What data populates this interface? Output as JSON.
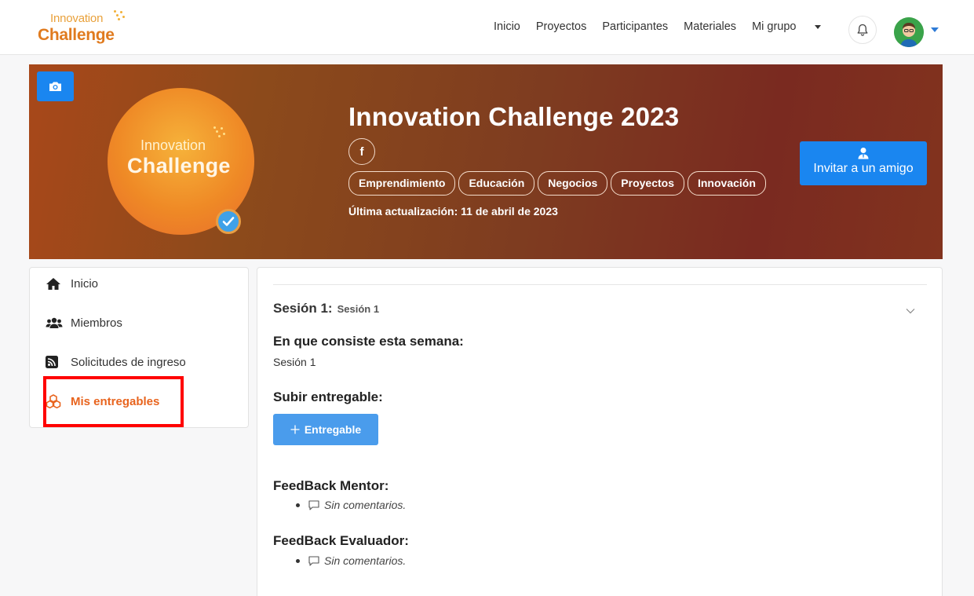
{
  "nav": {
    "logo_top": "Innovation",
    "logo_bottom": "Challenge",
    "links": [
      "Inicio",
      "Proyectos",
      "Participantes",
      "Materiales"
    ],
    "group_label": "Mi grupo"
  },
  "hero": {
    "badge_top": "Innovation",
    "badge_bottom": "Challenge",
    "title": "Innovation Challenge 2023",
    "fb_icon": "f",
    "tags": [
      "Emprendimiento",
      "Educación",
      "Negocios",
      "Proyectos",
      "Innovación"
    ],
    "updated": "Última actualización: 11 de abril de 2023",
    "invite_label": "Invitar a un amigo"
  },
  "sidebar": {
    "items": [
      {
        "label": "Inicio",
        "icon": "home-icon"
      },
      {
        "label": "Miembros",
        "icon": "users-icon"
      },
      {
        "label": "Solicitudes de ingreso",
        "icon": "rss-icon"
      },
      {
        "label": "Mis entregables",
        "icon": "cubes-icon"
      }
    ]
  },
  "main": {
    "session_label": "Sesión 1:",
    "session_sub": "Sesión 1",
    "week_heading": "En que consiste esta semana:",
    "week_text": "Sesión 1",
    "upload_heading": "Subir entregable:",
    "add_button": "Entregable",
    "mentor_heading": "FeedBack Mentor:",
    "mentor_comment": "Sin comentarios.",
    "evaluator_heading": "FeedBack Evaluador:",
    "evaluator_comment": "Sin comentarios."
  },
  "colors": {
    "accent": "#1a86f0",
    "active_sidebar": "#e8641e",
    "highlight": "#ff0000"
  }
}
